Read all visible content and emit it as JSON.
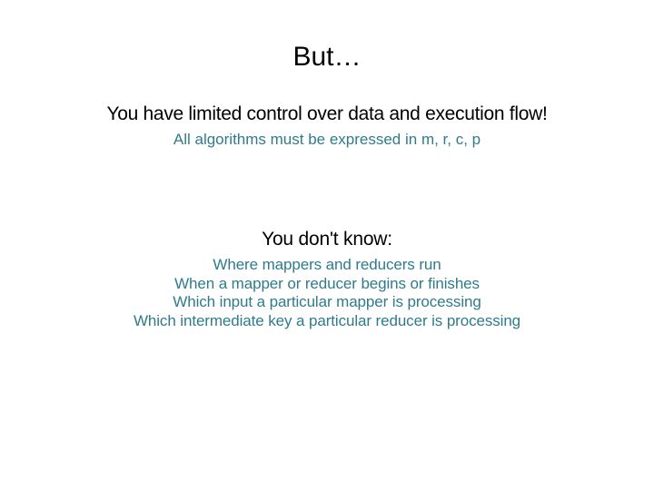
{
  "slide": {
    "title": "But…",
    "section1": {
      "heading": "You have limited control over data and execution flow!",
      "detail": "All algorithms must be expressed in m, r, c, p"
    },
    "section2": {
      "heading": "You don't know:",
      "bullets": [
        "Where mappers and reducers run",
        "When a mapper or reducer begins or finishes",
        "Which input a particular mapper is processing",
        "Which intermediate key a particular reducer is processing"
      ]
    }
  }
}
